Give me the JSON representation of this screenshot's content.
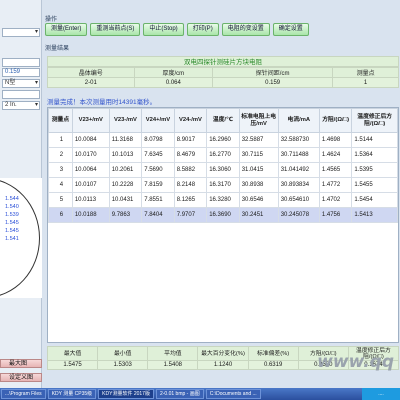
{
  "left_panel": {
    "inputs": [
      "0.159",
      "N型",
      "2 In."
    ],
    "plot_values": [
      "1.544",
      "1.540",
      "1.539",
      "1.545",
      "1.545",
      "1.541"
    ],
    "buttons": [
      "最大图",
      "设定义图"
    ]
  },
  "operations": {
    "label": "操作",
    "buttons": [
      "测量(Enter)",
      "重测当前点(S)",
      "中止(Stop)",
      "打印(P)",
      "电阻的变设置",
      "确定设置"
    ]
  },
  "results": {
    "label": "测量结果",
    "title": "双电四探针测硅片方块电阻",
    "headers": [
      "晶体编号",
      "厚度/cm",
      "探针间距/cm",
      "测量点"
    ],
    "values": [
      "2-01",
      "0.064",
      "0.159",
      "1"
    ]
  },
  "status_text": "测量完成！本次测量用时14391毫秒。",
  "grid": {
    "headers": [
      "测量点",
      "V23+/mV",
      "V23-/mV",
      "V24+/mV",
      "V24-/mV",
      "温度/℃",
      "标准电阻上电压/mV",
      "电流/mA",
      "方阻/(Ω/□)",
      "温度修正后方阻/(Ω/□)"
    ],
    "rows": [
      [
        "1",
        "10.0084",
        "11.3168",
        "8.0798",
        "8.9017",
        "16.2960",
        "32.5887",
        "32.588730",
        "1.4698",
        "1.5144"
      ],
      [
        "2",
        "10.0170",
        "10.1013",
        "7.6345",
        "8.4679",
        "16.2770",
        "30.7115",
        "30.711488",
        "1.4624",
        "1.5364"
      ],
      [
        "3",
        "10.0064",
        "10.2061",
        "7.5690",
        "8.5882",
        "16.3060",
        "31.0415",
        "31.041492",
        "1.4565",
        "1.5395"
      ],
      [
        "4",
        "10.0107",
        "10.2228",
        "7.8159",
        "8.2148",
        "16.3170",
        "30.8938",
        "30.893834",
        "1.4772",
        "1.5455"
      ],
      [
        "5",
        "10.0113",
        "10.0431",
        "7.8551",
        "8.1265",
        "16.3280",
        "30.6546",
        "30.654610",
        "1.4702",
        "1.5454"
      ],
      [
        "6",
        "10.0188",
        "9.7863",
        "7.8404",
        "7.9707",
        "16.3690",
        "30.2451",
        "30.245078",
        "1.4756",
        "1.5413"
      ]
    ]
  },
  "summary": {
    "headers": [
      "最大值",
      "最小值",
      "平均值",
      "最大百分变化(%)",
      "标准偏差(%)",
      "方阻/(Ω/□)",
      "温度修正后方阻/(Ω/□)"
    ],
    "values": [
      "1.5475",
      "1.5303",
      "1.5408",
      "1.1240",
      "0.6319",
      "0.2580",
      "0.1674"
    ]
  },
  "watermark": "www.qq",
  "taskbar": {
    "items": [
      "...\\Program Files",
      "KDY 测量 CP35级",
      "KDY测量软件 2017版",
      "2-0.01 bmp - 画图",
      "C:\\Documents and ..."
    ],
    "tray": "...."
  }
}
